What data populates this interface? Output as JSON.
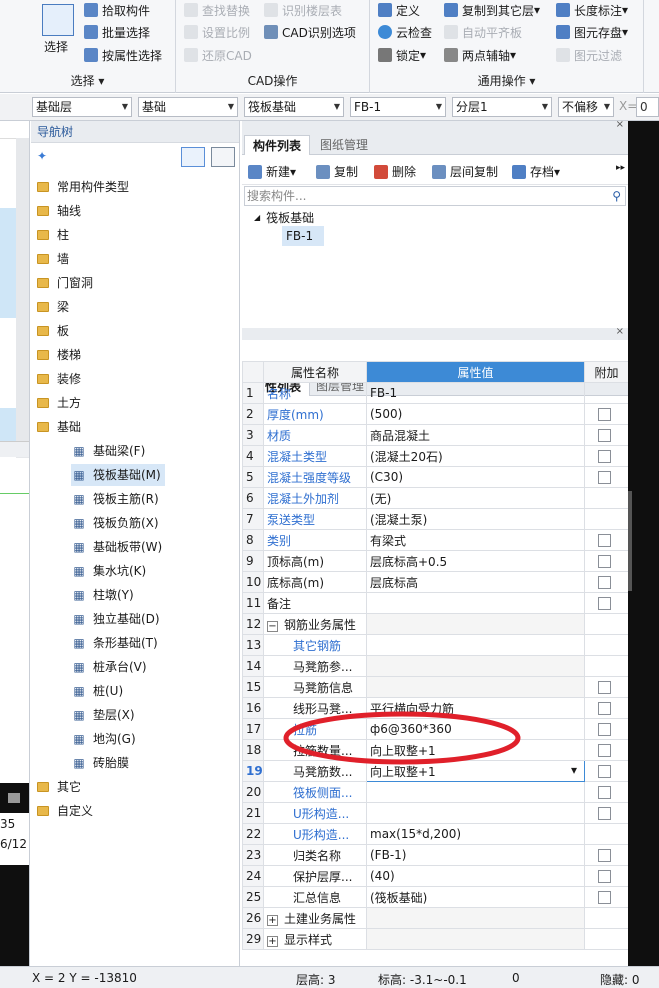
{
  "ribbon": {
    "groups": {
      "select": {
        "label": "选择",
        "big_button": "选择",
        "items": [
          "拾取构件",
          "批量选择",
          "按属性选择"
        ]
      },
      "cad": {
        "label": "CAD操作",
        "col1": [
          "查找替换",
          "设置比例",
          "还原CAD"
        ],
        "col2": [
          "识别楼层表",
          "CAD识别选项"
        ]
      },
      "common": {
        "label": "通用操作",
        "col1": [
          "定义",
          "云检查",
          "锁定"
        ],
        "col2": [
          "复制到其它层",
          "自动平齐板",
          "两点辅轴"
        ],
        "col3": [
          "长度标注",
          "图元存盘",
          "图元过滤"
        ]
      }
    }
  },
  "selectors": {
    "layer_type": "基础层",
    "category": "基础",
    "type": "筏板基础",
    "component": "FB-1",
    "sublayer": "分层1",
    "offset": "不偏移",
    "x_label": "X=",
    "x_value": "0"
  },
  "left_strip": {
    "value1": "35",
    "value2": "6/12"
  },
  "nav": {
    "title": "导航树",
    "folders": [
      "常用构件类型",
      "轴线",
      "柱",
      "墙",
      "门窗洞",
      "梁",
      "板",
      "楼梯",
      "装修",
      "土方",
      "基础"
    ],
    "children": [
      "基础梁(F)",
      "筏板基础(M)",
      "筏板主筋(R)",
      "筏板负筋(X)",
      "基础板带(W)",
      "集水坑(K)",
      "柱墩(Y)",
      "独立基础(D)",
      "条形基础(T)",
      "桩承台(V)",
      "桩(U)",
      "垫层(X)",
      "地沟(G)",
      "砖胎膜"
    ],
    "after": [
      "其它",
      "自定义"
    ],
    "selected": "筏板基础(M)"
  },
  "component_panel": {
    "tabs": [
      "构件列表",
      "图纸管理"
    ],
    "toolbar": [
      "新建",
      "复制",
      "删除",
      "层间复制",
      "存档"
    ],
    "search_placeholder": "搜索构件...",
    "tree_root": "筏板基础",
    "tree_item": "FB-1"
  },
  "property_panel": {
    "tabs": [
      "属性列表",
      "图层管理"
    ],
    "headers": [
      "属性名称",
      "属性值",
      "附加"
    ],
    "rows": [
      {
        "n": "1",
        "name": "名称",
        "value": "FB-1",
        "blue": true,
        "cb": false
      },
      {
        "n": "2",
        "name": "厚度(mm)",
        "value": "(500)",
        "blue": true,
        "cb": true
      },
      {
        "n": "3",
        "name": "材质",
        "value": "商品混凝土",
        "blue": true,
        "cb": true
      },
      {
        "n": "4",
        "name": "混凝土类型",
        "value": "(混凝土20石)",
        "blue": true,
        "cb": true
      },
      {
        "n": "5",
        "name": "混凝土强度等级",
        "value": "(C30)",
        "blue": true,
        "cb": true
      },
      {
        "n": "6",
        "name": "混凝土外加剂",
        "value": "(无)",
        "blue": true,
        "cb": false
      },
      {
        "n": "7",
        "name": "泵送类型",
        "value": "(混凝土泵)",
        "blue": true,
        "cb": false
      },
      {
        "n": "8",
        "name": "类别",
        "value": "有梁式",
        "blue": true,
        "cb": true
      },
      {
        "n": "9",
        "name": "顶标高(m)",
        "value": "层底标高+0.5",
        "blue": false,
        "cb": true
      },
      {
        "n": "10",
        "name": "底标高(m)",
        "value": "层底标高",
        "blue": false,
        "cb": true
      },
      {
        "n": "11",
        "name": "备注",
        "value": "",
        "blue": false,
        "cb": true
      },
      {
        "n": "12",
        "name": "钢筋业务属性",
        "value": "",
        "blue": false,
        "cb": false,
        "group": "−"
      },
      {
        "n": "13",
        "name": "其它钢筋",
        "value": "",
        "blue": true,
        "cb": false,
        "indent": true
      },
      {
        "n": "14",
        "name": "马凳筋参...",
        "value": "",
        "blue": false,
        "cb": false,
        "indent": true
      },
      {
        "n": "15",
        "name": "马凳筋信息",
        "value": "",
        "blue": false,
        "cb": true,
        "indent": true
      },
      {
        "n": "16",
        "name": "线形马凳...",
        "value": "平行横向受力筋",
        "blue": false,
        "cb": true,
        "indent": true
      },
      {
        "n": "17",
        "name": "拉筋",
        "value": "ф6@360*360",
        "blue": true,
        "cb": true,
        "indent": true
      },
      {
        "n": "18",
        "name": "拉筋数量...",
        "value": "向上取整+1",
        "blue": false,
        "cb": true,
        "indent": true
      },
      {
        "n": "19",
        "name": "马凳筋数...",
        "value": "向上取整+1",
        "blue": false,
        "cb": true,
        "indent": true,
        "active": true
      },
      {
        "n": "20",
        "name": "筏板侧面...",
        "value": "",
        "blue": true,
        "cb": true,
        "indent": true
      },
      {
        "n": "21",
        "name": "U形构造...",
        "value": "",
        "blue": true,
        "cb": true,
        "indent": true
      },
      {
        "n": "22",
        "name": "U形构造...",
        "value": "max(15*d,200)",
        "blue": true,
        "cb": false,
        "indent": true
      },
      {
        "n": "23",
        "name": "归类名称",
        "value": "(FB-1)",
        "blue": false,
        "cb": true,
        "indent": true
      },
      {
        "n": "24",
        "name": "保护层厚...",
        "value": "(40)",
        "blue": false,
        "cb": true,
        "indent": true
      },
      {
        "n": "25",
        "name": "汇总信息",
        "value": "(筏板基础)",
        "blue": false,
        "cb": true,
        "indent": true
      },
      {
        "n": "26",
        "name": "土建业务属性",
        "value": "",
        "blue": false,
        "cb": false,
        "group": "+"
      },
      {
        "n": "29",
        "name": "显示样式",
        "value": "",
        "blue": false,
        "cb": false,
        "group": "+"
      }
    ]
  },
  "status": {
    "coords": "X = 2 Y = -13810",
    "floor_height": "层高:  3",
    "elevation": "标高:  -3.1~-0.1",
    "zero": "0",
    "hidden": "隐藏:  0"
  }
}
